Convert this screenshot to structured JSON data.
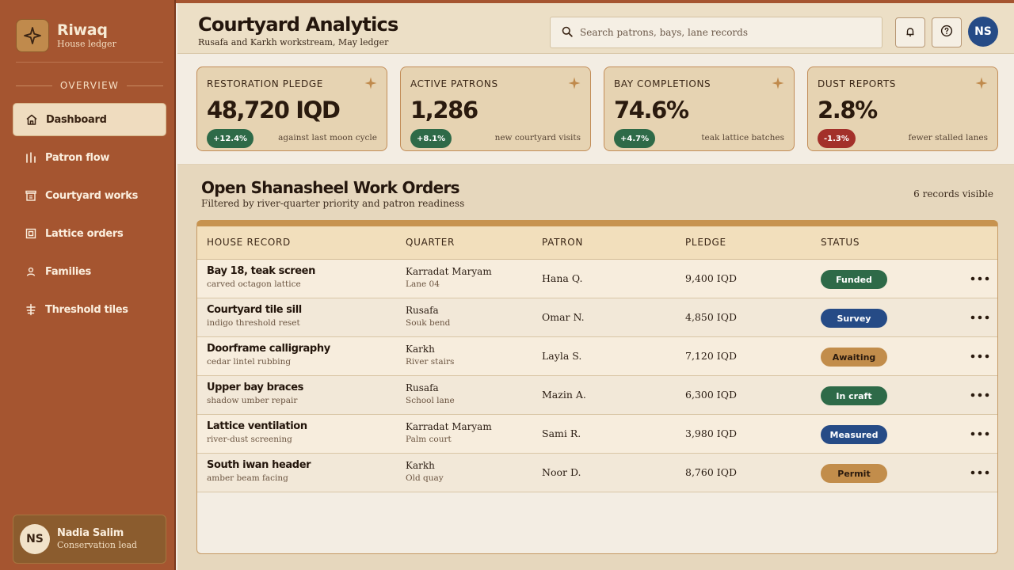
{
  "colors": {
    "sidebar": "#a55530",
    "accent": "#c08a4c",
    "positive": "#2e6a48",
    "negative": "#a3302a",
    "blue": "#264b86",
    "amber": "#c28d4b"
  },
  "brand": {
    "name": "Riwaq",
    "subtitle": "House ledger",
    "icon": "sparkle-icon"
  },
  "sidebar": {
    "section_label": "OVERVIEW",
    "items": [
      {
        "label": "Dashboard",
        "icon": "home-icon",
        "active": true
      },
      {
        "label": "Patron flow",
        "icon": "bars-icon",
        "active": false
      },
      {
        "label": "Courtyard works",
        "icon": "archive-icon",
        "active": false
      },
      {
        "label": "Lattice orders",
        "icon": "grid-square-icon",
        "active": false
      },
      {
        "label": "Families",
        "icon": "person-icon",
        "active": false
      },
      {
        "label": "Threshold tiles",
        "icon": "tile-icon",
        "active": false
      }
    ],
    "user": {
      "initials": "NS",
      "name": "Nadia Salim",
      "role": "Conservation lead"
    }
  },
  "header": {
    "title": "Courtyard Analytics",
    "subtitle": "Rusafa and Karkh workstream, May ledger",
    "search_placeholder": "Search patrons, bays, lane records",
    "avatar_initials": "NS"
  },
  "kpis": [
    {
      "label": "RESTORATION PLEDGE",
      "value": "48,720 IQD",
      "change": "+12.4%",
      "trend": "up",
      "note": "against last moon cycle"
    },
    {
      "label": "ACTIVE PATRONS",
      "value": "1,286",
      "change": "+8.1%",
      "trend": "up",
      "note": "new courtyard visits"
    },
    {
      "label": "BAY COMPLETIONS",
      "value": "74.6%",
      "change": "+4.7%",
      "trend": "up",
      "note": "teak lattice batches"
    },
    {
      "label": "DUST REPORTS",
      "value": "2.8%",
      "change": "-1.3%",
      "trend": "down",
      "note": "fewer stalled lanes"
    }
  ],
  "orders": {
    "title": "Open Shanasheel Work Orders",
    "subtitle": "Filtered by river-quarter priority and patron readiness",
    "count_text": "6 records visible",
    "columns": [
      "HOUSE RECORD",
      "QUARTER",
      "PATRON",
      "PLEDGE",
      "STATUS"
    ],
    "rows": [
      {
        "title": "Bay 18, teak screen",
        "desc": "carved octagon lattice",
        "quarter": "Karradat Maryam",
        "lane": "Lane 04",
        "patron": "Hana Q.",
        "pledge": "9,400 IQD",
        "status": "Funded",
        "status_color": "#2e6a48"
      },
      {
        "title": "Courtyard tile sill",
        "desc": "indigo threshold reset",
        "quarter": "Rusafa",
        "lane": "Souk bend",
        "patron": "Omar N.",
        "pledge": "4,850 IQD",
        "status": "Survey",
        "status_color": "#264b86"
      },
      {
        "title": "Doorframe calligraphy",
        "desc": "cedar lintel rubbing",
        "quarter": "Karkh",
        "lane": "River stairs",
        "patron": "Layla S.",
        "pledge": "7,120 IQD",
        "status": "Awaiting",
        "status_color": "#c28d4b"
      },
      {
        "title": "Upper bay braces",
        "desc": "shadow umber repair",
        "quarter": "Rusafa",
        "lane": "School lane",
        "patron": "Mazin A.",
        "pledge": "6,300 IQD",
        "status": "In craft",
        "status_color": "#2e6a48"
      },
      {
        "title": "Lattice ventilation",
        "desc": "river-dust screening",
        "quarter": "Karradat Maryam",
        "lane": "Palm court",
        "patron": "Sami R.",
        "pledge": "3,980 IQD",
        "status": "Measured",
        "status_color": "#264b86"
      },
      {
        "title": "South iwan header",
        "desc": "amber beam facing",
        "quarter": "Karkh",
        "lane": "Old quay",
        "patron": "Noor D.",
        "pledge": "8,760 IQD",
        "status": "Permit",
        "status_color": "#c28d4b"
      }
    ]
  }
}
